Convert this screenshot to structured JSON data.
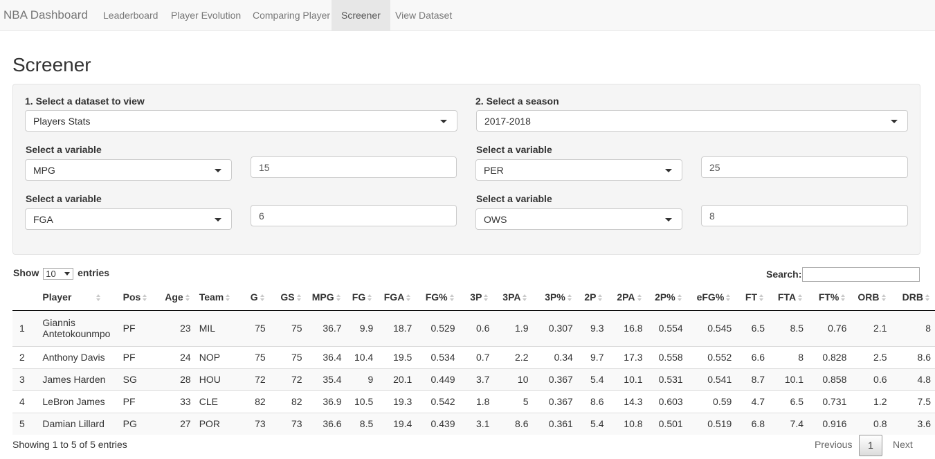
{
  "navbar": {
    "brand": "NBA Dashboard",
    "tabs": [
      {
        "label": "Leaderboard",
        "active": false
      },
      {
        "label": "Player Evolution",
        "active": false
      },
      {
        "label": "Comparing Player",
        "active": false
      },
      {
        "label": "Screener",
        "active": true
      },
      {
        "label": "View Dataset",
        "active": false
      }
    ]
  },
  "page": {
    "title": "Screener"
  },
  "filters": {
    "dataset_label": "1. Select a dataset to view",
    "dataset_value": "Players Stats",
    "season_label": "2. Select a season",
    "season_value": "2017-2018",
    "var1_label": "Select a variable",
    "var1_value": "MPG",
    "var1_threshold": "15",
    "var2_label": "Select a variable",
    "var2_value": "PER",
    "var2_threshold": "25",
    "var3_label": "Select a variable",
    "var3_value": "FGA",
    "var3_threshold": "6",
    "var4_label": "Select a variable",
    "var4_value": "OWS",
    "var4_threshold": "8"
  },
  "table_controls": {
    "show_label": "Show",
    "entries_value": "10",
    "entries_label": "entries",
    "search_label": "Search:"
  },
  "table": {
    "columns": [
      "",
      "Player",
      "Pos",
      "Age",
      "Team",
      "G",
      "GS",
      "MPG",
      "FG",
      "FGA",
      "FG%",
      "3P",
      "3PA",
      "3P%",
      "2P",
      "2PA",
      "2P%",
      "eFG%",
      "FT",
      "FTA",
      "FT%",
      "ORB",
      "DRB"
    ],
    "rows": [
      [
        "1",
        "Giannis Antetokounmpo",
        "PF",
        "23",
        "MIL",
        "75",
        "75",
        "36.7",
        "9.9",
        "18.7",
        "0.529",
        "0.6",
        "1.9",
        "0.307",
        "9.3",
        "16.8",
        "0.554",
        "0.545",
        "6.5",
        "8.5",
        "0.76",
        "2.1",
        "8"
      ],
      [
        "2",
        "Anthony Davis",
        "PF",
        "24",
        "NOP",
        "75",
        "75",
        "36.4",
        "10.4",
        "19.5",
        "0.534",
        "0.7",
        "2.2",
        "0.34",
        "9.7",
        "17.3",
        "0.558",
        "0.552",
        "6.6",
        "8",
        "0.828",
        "2.5",
        "8.6"
      ],
      [
        "3",
        "James Harden",
        "SG",
        "28",
        "HOU",
        "72",
        "72",
        "35.4",
        "9",
        "20.1",
        "0.449",
        "3.7",
        "10",
        "0.367",
        "5.4",
        "10.1",
        "0.531",
        "0.541",
        "8.7",
        "10.1",
        "0.858",
        "0.6",
        "4.8"
      ],
      [
        "4",
        "LeBron James",
        "PF",
        "33",
        "CLE",
        "82",
        "82",
        "36.9",
        "10.5",
        "19.3",
        "0.542",
        "1.8",
        "5",
        "0.367",
        "8.6",
        "14.3",
        "0.603",
        "0.59",
        "4.7",
        "6.5",
        "0.731",
        "1.2",
        "7.5"
      ],
      [
        "5",
        "Damian Lillard",
        "PG",
        "27",
        "POR",
        "73",
        "73",
        "36.6",
        "8.5",
        "19.4",
        "0.439",
        "3.1",
        "8.6",
        "0.361",
        "5.4",
        "10.8",
        "0.501",
        "0.519",
        "6.8",
        "7.4",
        "0.916",
        "0.8",
        "3.6"
      ]
    ]
  },
  "footer": {
    "info": "Showing 1 to 5 of 5 entries",
    "previous": "Previous",
    "page": "1",
    "next": "Next"
  }
}
